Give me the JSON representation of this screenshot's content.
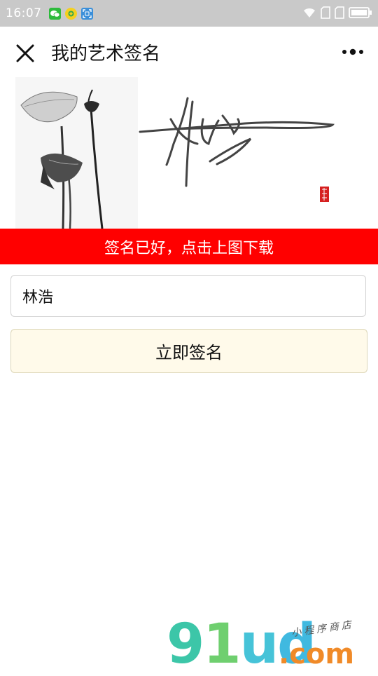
{
  "status_bar": {
    "time": "16:07",
    "app_icons": [
      "wechat-icon",
      "lotus-app-icon",
      "scan-app-icon"
    ],
    "system_icons": [
      "wifi-icon",
      "sim1-icon",
      "sim2-icon",
      "battery-icon"
    ]
  },
  "nav": {
    "title": "我的艺术签名",
    "close_icon": "close-icon",
    "more_icon": "more-icon"
  },
  "banner": {
    "artwork": "lotus-ink-painting",
    "signature_text": "林浩",
    "seal": "red-seal-stamp"
  },
  "notice": {
    "text": "签名已好，点击上图下载",
    "background": "#ff0000"
  },
  "form": {
    "name_value": "林浩",
    "button_label": "立即签名",
    "button_bg": "#fffaea"
  },
  "watermark": {
    "brand": "91ud",
    "brand_parts": [
      "9",
      "1",
      "u",
      "d"
    ],
    "dotcom": ".com",
    "subtitle": "小程序商店"
  }
}
